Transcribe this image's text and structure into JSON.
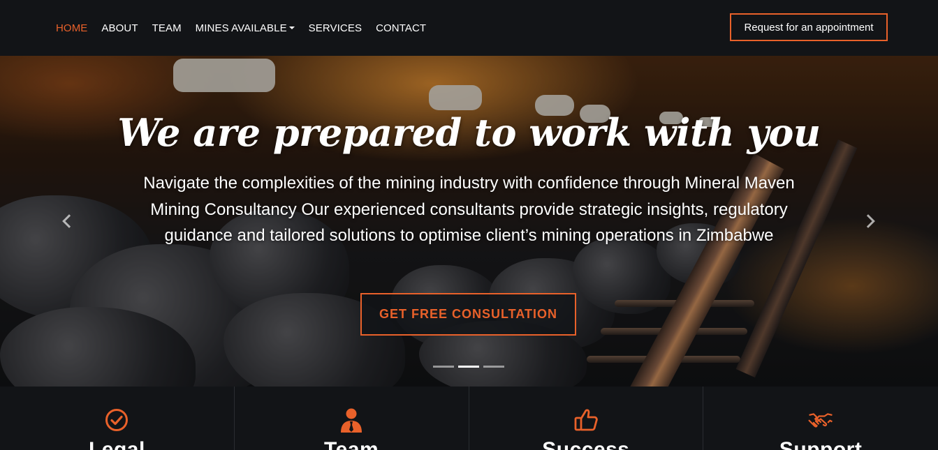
{
  "nav": {
    "links": [
      {
        "label": "HOME",
        "active": true
      },
      {
        "label": "ABOUT"
      },
      {
        "label": "TEAM"
      },
      {
        "label": "MINES AVAILABLE",
        "dropdown": true
      },
      {
        "label": "SERVICES"
      },
      {
        "label": "CONTACT"
      }
    ],
    "appointment_label": "Request for an appointment"
  },
  "hero": {
    "title": "We are prepared to work with you",
    "text": "Navigate the complexities of the mining industry with confidence through Mineral Maven Mining Consultancy Our experienced consultants provide strategic insights, regulatory guidance and tailored solutions to optimise client’s mining operations in Zimbabwe",
    "cta_label": "GET FREE CONSULTATION",
    "active_slide": 2,
    "slide_count": 3
  },
  "features": [
    {
      "icon": "check-circle-icon",
      "title": "Legal"
    },
    {
      "icon": "user-tie-icon",
      "title": "Team"
    },
    {
      "icon": "thumbs-up-icon",
      "title": "Success"
    },
    {
      "icon": "handshake-icon",
      "title": "Support"
    }
  ],
  "colors": {
    "accent": "#e9612a",
    "dark": "#121417",
    "text": "#ffffff"
  }
}
